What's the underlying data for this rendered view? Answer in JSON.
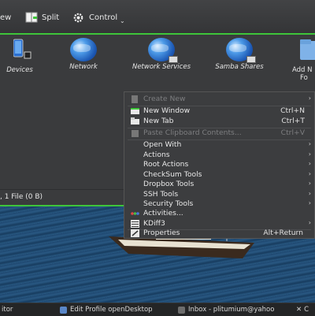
{
  "toolbar": {
    "view_label": "ew",
    "split_label": "Split",
    "control_label": "Control"
  },
  "places": [
    {
      "label": "Devices"
    },
    {
      "label": "Network"
    },
    {
      "label": "Network Services"
    },
    {
      "label": "Samba Shares"
    },
    {
      "label": "Add N",
      "label2": "Fo"
    }
  ],
  "status": {
    "text": ", 1 File (0 B)"
  },
  "context_menu": {
    "items": [
      {
        "label": "Create New",
        "shortcut": "",
        "submenu": true,
        "disabled": true
      },
      {
        "label": "New Window",
        "shortcut": "Ctrl+N",
        "submenu": false,
        "disabled": false
      },
      {
        "label": "New Tab",
        "shortcut": "Ctrl+T",
        "submenu": false,
        "disabled": false
      },
      {
        "label": "Paste Clipboard Contents...",
        "shortcut": "Ctrl+V",
        "submenu": false,
        "disabled": true
      },
      {
        "label": "Open With",
        "shortcut": "",
        "submenu": true,
        "disabled": false
      },
      {
        "label": "Actions",
        "shortcut": "",
        "submenu": true,
        "disabled": false
      },
      {
        "label": "Root Actions",
        "shortcut": "",
        "submenu": true,
        "disabled": false
      },
      {
        "label": "CheckSum Tools",
        "shortcut": "",
        "submenu": true,
        "disabled": false
      },
      {
        "label": "Dropbox Tools",
        "shortcut": "",
        "submenu": true,
        "disabled": false
      },
      {
        "label": "SSH Tools",
        "shortcut": "",
        "submenu": true,
        "disabled": false
      },
      {
        "label": "Security Tools",
        "shortcut": "",
        "submenu": true,
        "disabled": false
      },
      {
        "label": "Activities...",
        "shortcut": "",
        "submenu": false,
        "disabled": false
      },
      {
        "label": "KDiff3",
        "shortcut": "",
        "submenu": true,
        "disabled": false
      },
      {
        "label": "Properties",
        "shortcut": "Alt+Return",
        "submenu": false,
        "disabled": false
      }
    ]
  },
  "taskbar": {
    "items": [
      {
        "label": "itor"
      },
      {
        "label": "Edit Profile openDesktop"
      },
      {
        "label": "Inbox - plitumium@yahoo"
      },
      {
        "label": "C"
      }
    ]
  },
  "colors": {
    "accent": "#3ec53a",
    "menu_bg": "#3c3d3f",
    "window_bg": "#3a3b3d"
  }
}
